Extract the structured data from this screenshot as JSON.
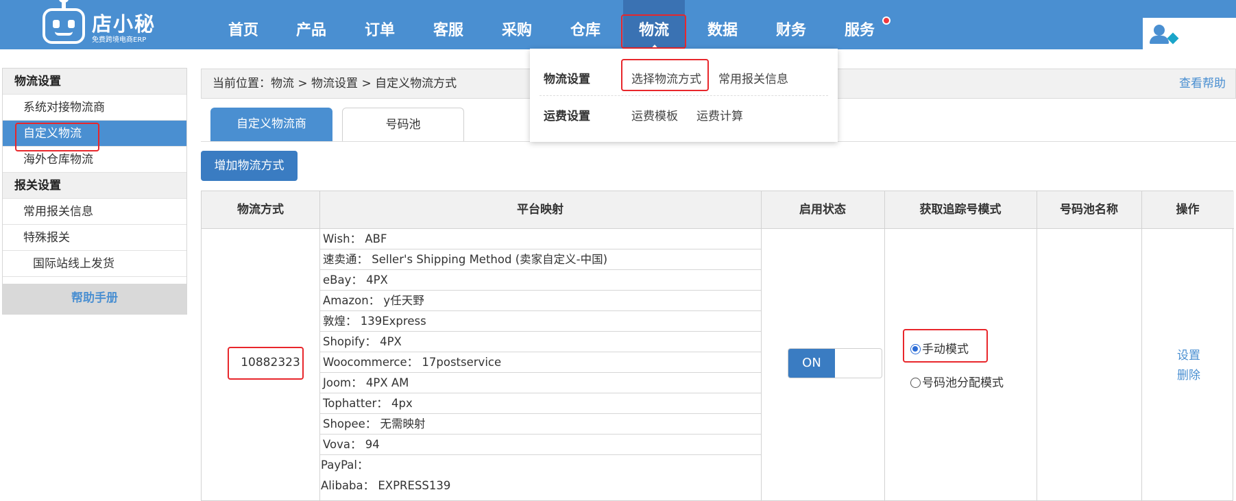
{
  "logo": {
    "name": "店小秘",
    "slogan": "免费跨境电商ERP"
  },
  "nav": {
    "items": [
      "首页",
      "产品",
      "订单",
      "客服",
      "采购",
      "仓库",
      "物流",
      "数据",
      "财务",
      "服务"
    ],
    "active": "物流"
  },
  "dropdown": {
    "group1": "物流设置",
    "group1_links": [
      "选择物流方式",
      "常用报关信息"
    ],
    "group2": "运费设置",
    "group2_links": [
      "运费模板",
      "运费计算"
    ]
  },
  "sidebar": {
    "section1": "物流设置",
    "items1": [
      "系统对接物流商",
      "自定义物流",
      "海外仓库物流"
    ],
    "section2": "报关设置",
    "items2": [
      "常用报关信息",
      "特殊报关",
      "国际站线上发货"
    ],
    "help": "帮助手册"
  },
  "breadcrumb": {
    "text": "当前位置：物流 > 物流设置 > 自定义物流方式",
    "help": "查看帮助"
  },
  "tabs": [
    "自定义物流商",
    "号码池"
  ],
  "add_button": "增加物流方式",
  "table": {
    "headers": [
      "物流方式",
      "平台映射",
      "启用状态",
      "获取追踪号模式",
      "号码池名称",
      "操作"
    ],
    "row": {
      "code": "10882323",
      "mappings": [
        "Wish： ABF",
        "速卖通： Seller's Shipping Method (卖家自定义-中国)",
        "eBay： 4PX",
        "Amazon： y任天野",
        "敦煌： 139Express",
        "Shopify： 4PX",
        "Woocommerce： 17postservice",
        "Joom： 4PX AM",
        "Tophatter： 4px",
        "Shopee： 无需映射",
        "Vova： 94",
        "PayPal：",
        "Alibaba： EXPRESS139"
      ],
      "toggle": "ON",
      "mode_options": [
        "手动模式",
        "号码池分配模式"
      ],
      "mode_selected": "手动模式",
      "actions": [
        "设置",
        "删除"
      ]
    }
  },
  "colors": {
    "brand": "#4a8fd1",
    "highlight": "#e8262b"
  }
}
